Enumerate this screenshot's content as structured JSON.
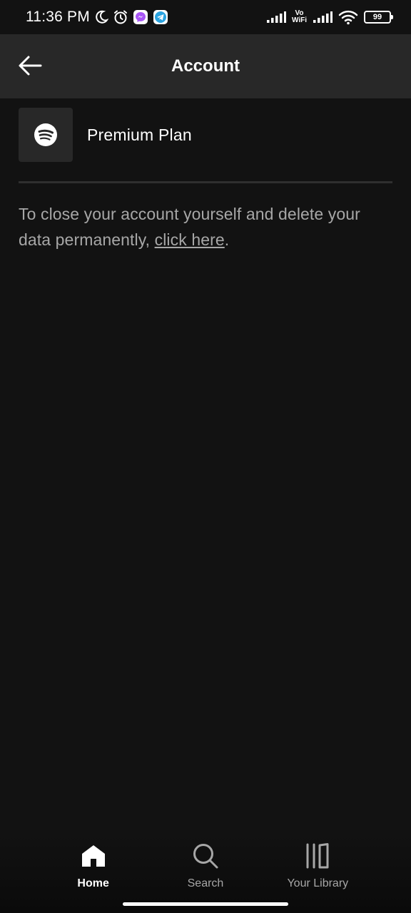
{
  "status_bar": {
    "time": "11:36 PM",
    "vo_label_top": "Vo",
    "vo_label_bottom": "WiFi",
    "battery": "99"
  },
  "header": {
    "title": "Account"
  },
  "plan": {
    "name": "Premium Plan"
  },
  "close_account": {
    "text": "To close your account yourself and delete your data permanently, ",
    "link_label": "click here",
    "suffix": "."
  },
  "bottom_nav": {
    "items": [
      {
        "label": "Home",
        "active": true
      },
      {
        "label": "Search",
        "active": false
      },
      {
        "label": "Your Library",
        "active": false
      }
    ]
  },
  "colors": {
    "background": "#121212",
    "header_bg": "#282828",
    "text_primary": "#ffffff",
    "text_secondary": "#a7a7a7",
    "messenger_icon": "#a855f7",
    "telegram_icon": "#2aa3e0"
  }
}
